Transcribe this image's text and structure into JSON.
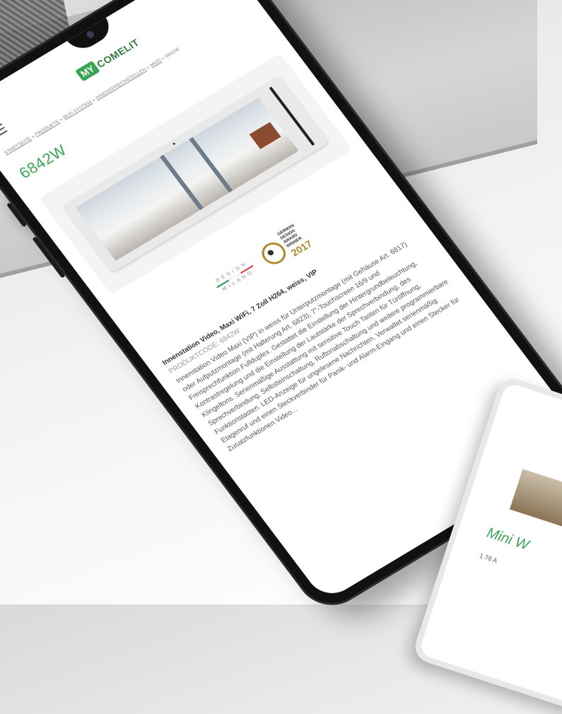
{
  "header": {
    "logo_badge": "MY",
    "logo_text": "COMELIT"
  },
  "breadcrumb": {
    "items": [
      "STARTSEITE",
      "PRODUKTE",
      "BUS-SYSTEM",
      "INNENSPRECHSTELLEN",
      "MAXI",
      "6842W"
    ],
    "separator": "»"
  },
  "page": {
    "title": "6842W"
  },
  "awards": {
    "design_top": "DESIGN",
    "design_bottom": "MILANO",
    "gda_lines": [
      "GERMAN",
      "DESIGN",
      "AWARD",
      "WINNER"
    ],
    "gda_year": "2017"
  },
  "product": {
    "name": "Innenstation Video, Maxi WiFi, 7 Zoll H264, weiss, VIP",
    "code": "PRODUKTCODE: 6842W",
    "description": "Innenstation Video Maxi (VIP) in weiss für Unterputzmontage (mit Gehäuse Art. 6817) oder Aufputzmontage (mit Halterung Art. 6823), 7\"-Touchscreen 16/9 und Freisprechfunktion Fullduplex. Gestattet die Einstellung der Hintergrundbeleuchtung, Kontrastregelung und die Einstellung der Lautstärke der Sprechverbindung, des Klingeltons. Serienmäßige Ausstattung mit sensitive Touch Tasten für Türöffnung, Sprechverbindung, Selbsteinschaltung, Ruftonabschaltung und weitere programmierbare Funktionstasten. LED-Anzeige für ungelesene Nachrichten. Verwaltet serienmäßig Etagenruf und einen Steckverbinder für Panik- und Alarm-Eingang und einen Stecker für Zusatzfunktionen Video..."
  },
  "second_phone": {
    "title": "Mini W",
    "text": "1.78 A"
  }
}
